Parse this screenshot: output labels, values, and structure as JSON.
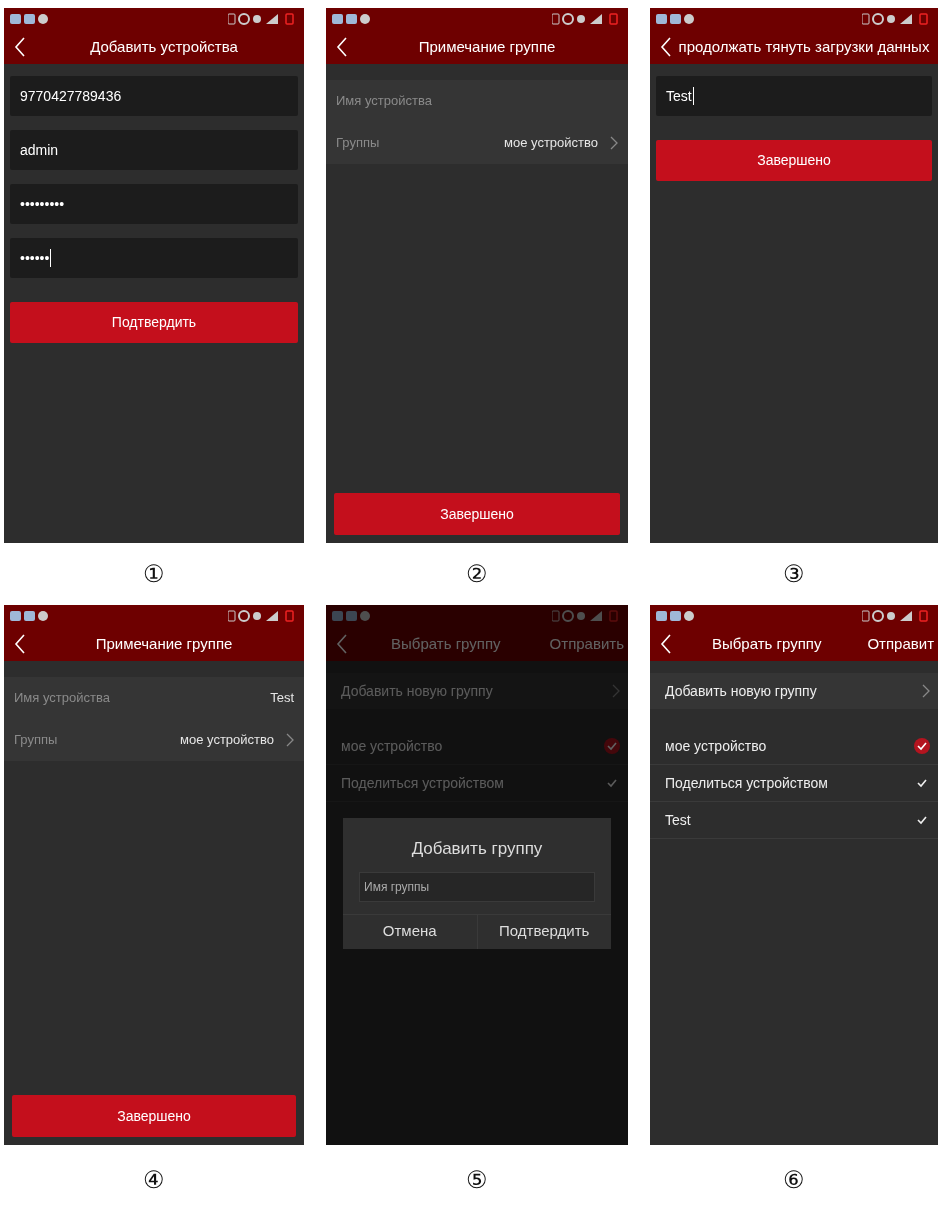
{
  "panels": [
    {
      "caption": "①",
      "title": "Добавить устройства",
      "back": true,
      "content": [
        {
          "kind": "field",
          "value": "9770427789436",
          "focused": false
        },
        {
          "kind": "field",
          "value": "admin",
          "focused": false
        },
        {
          "kind": "field",
          "value": "•••••••••",
          "focused": false
        },
        {
          "kind": "field",
          "value": "••••••",
          "focused": true
        },
        {
          "kind": "button",
          "label": "Подтвердить"
        }
      ]
    },
    {
      "caption": "②",
      "title": "Примечание группе",
      "back": true,
      "content": [
        {
          "kind": "row",
          "label": "Имя устройства",
          "chevron": false
        },
        {
          "kind": "row",
          "label": "Группы",
          "value": "мое устройство",
          "chevron": true
        },
        {
          "kind": "footer_button",
          "label": "Завершено"
        }
      ]
    },
    {
      "caption": "③",
      "title": "продолжать тянуть загрузки данных",
      "back": true,
      "content": [
        {
          "kind": "field",
          "value": "Test",
          "focused": true
        },
        {
          "kind": "button",
          "label": "Завершено"
        }
      ]
    },
    {
      "caption": "④",
      "title": "Примечание группе",
      "back": true,
      "content": [
        {
          "kind": "row",
          "label": "Имя устройства",
          "value": "Test",
          "chevron": false
        },
        {
          "kind": "row",
          "label": "Группы",
          "value": "мое устройство",
          "chevron": true
        },
        {
          "kind": "footer_button",
          "label": "Завершено"
        }
      ]
    },
    {
      "caption": "⑤",
      "title": "Выбрать группу",
      "action": "Отправить",
      "back": true,
      "dimmed": true,
      "content": [
        {
          "kind": "link_row",
          "label": "Добавить новую группу"
        },
        {
          "kind": "check_row",
          "label": "мое устройство",
          "selected": true
        },
        {
          "kind": "check_row",
          "label": "Поделиться устройством",
          "selected": false
        }
      ],
      "dialog": {
        "title": "Добавить группу",
        "placeholder": "Имя группы",
        "buttons": [
          "Отмена",
          "Подтвердить"
        ]
      }
    },
    {
      "caption": "⑥",
      "title": "Выбрать группу",
      "action": "Отправит",
      "back": true,
      "content": [
        {
          "kind": "link_row",
          "label": "Добавить новую группу"
        },
        {
          "kind": "check_row",
          "label": "мое устройство",
          "selected": true
        },
        {
          "kind": "check_row",
          "label": "Поделиться устройством",
          "selected": false
        },
        {
          "kind": "check_row",
          "label": "Test",
          "selected": false
        }
      ]
    }
  ]
}
